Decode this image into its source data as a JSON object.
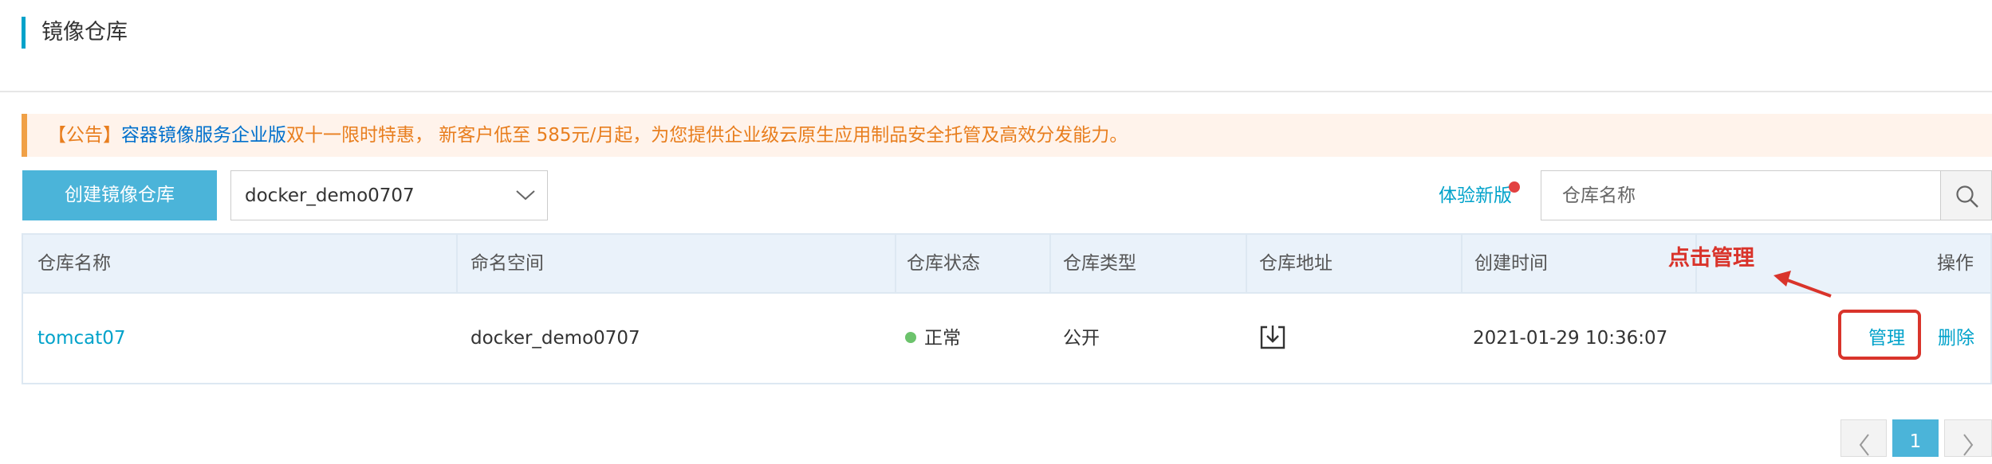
{
  "header": {
    "title": "镜像仓库"
  },
  "notice": {
    "prefix": "【公告】",
    "link_text": "容器镜像服务企业版",
    "message": "双十一限时特惠， 新客户低至 585元/月起，为您提供企业级云原生应用制品安全托管及高效分发能力。"
  },
  "toolbar": {
    "create_label": "创建镜像仓库",
    "namespace_selected": "docker_demo0707",
    "try_new_label": "体验新版",
    "search_placeholder": "仓库名称"
  },
  "table": {
    "headers": [
      "仓库名称",
      "命名空间",
      "仓库状态",
      "仓库类型",
      "仓库地址",
      "创建时间",
      "操作"
    ],
    "rows": [
      {
        "name": "tomcat07",
        "namespace": "docker_demo0707",
        "status": "正常",
        "type": "公开",
        "created": "2021-01-29 10:36:07",
        "manage_label": "管理",
        "delete_label": "删除"
      }
    ]
  },
  "annotation": {
    "text": "点击管理"
  },
  "pagination": {
    "current_page": "1"
  },
  "colors": {
    "accent": "#00a2ca",
    "primary_button": "#4bb4d9",
    "notice_text": "#e87e1e",
    "status_ok": "#6cc36c",
    "annotation": "#d9342b"
  }
}
